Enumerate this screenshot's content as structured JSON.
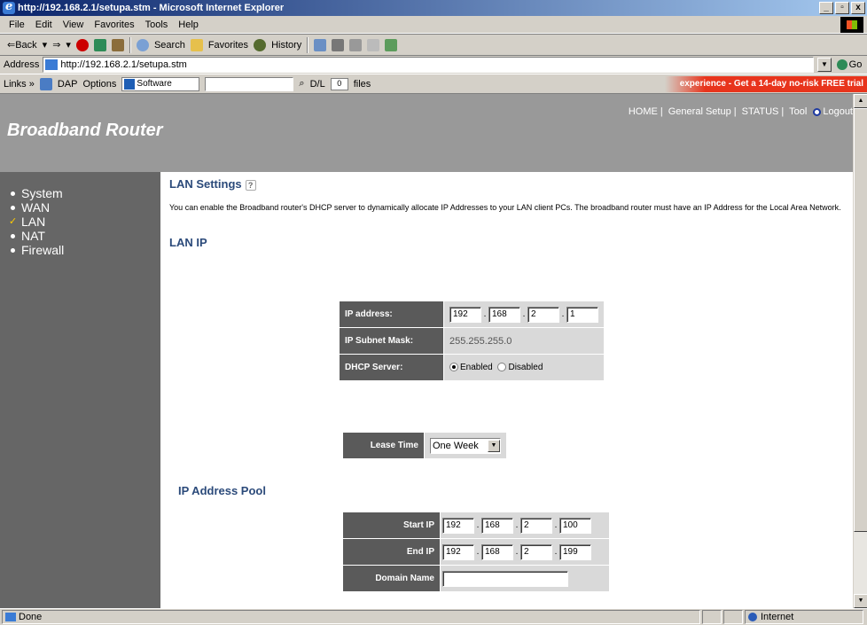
{
  "window": {
    "title": "http://192.168.2.1/setupa.stm - Microsoft Internet Explorer",
    "controls": [
      "_",
      "▫",
      "x"
    ]
  },
  "menu": [
    "File",
    "Edit",
    "View",
    "Favorites",
    "Tools",
    "Help"
  ],
  "toolbar": {
    "back": "⇐Back",
    "forward": "⇒",
    "search": "Search",
    "favorites": "Favorites",
    "history": "History"
  },
  "address": {
    "label": "Address",
    "url": "http://192.168.2.1/setupa.stm",
    "go": "Go"
  },
  "links": {
    "label": "Links »",
    "dap": "DAP",
    "options": "Options",
    "software": "Software",
    "dl": "D/L",
    "dl_count": "0",
    "files": "files",
    "promo": "experience - Get a 14-day no-risk FREE trial"
  },
  "router": {
    "brand": "Broadband Router",
    "topnav": [
      "HOME",
      "General Setup",
      "STATUS",
      "Tool"
    ],
    "logout": "Logout",
    "sidebar": [
      "System",
      "WAN",
      "LAN",
      "NAT",
      "Firewall"
    ],
    "lan_settings_title": "LAN Settings",
    "description": "You can enable the Broadband router's DHCP server to dynamically allocate IP Addresses to your LAN client PCs. The broadband router must have an IP Address for the Local Area Network.",
    "lan_ip_title": "LAN IP",
    "lan_ip": {
      "ip_label": "IP address:",
      "ip": [
        "192",
        "168",
        "2",
        "1"
      ],
      "mask_label": "IP Subnet Mask:",
      "mask": "255.255.255.0",
      "dhcp_label": "DHCP Server:",
      "enabled": "Enabled",
      "disabled": "Disabled"
    },
    "lease": {
      "label": "Lease Time",
      "value": "One Week"
    },
    "pool_title": "IP Address Pool",
    "pool": {
      "start_label": "Start IP",
      "start": [
        "192",
        "168",
        "2",
        "100"
      ],
      "end_label": "End IP",
      "end": [
        "192",
        "168",
        "2",
        "199"
      ],
      "domain_label": "Domain Name"
    }
  },
  "status": {
    "left": "Done",
    "zone": "Internet"
  }
}
